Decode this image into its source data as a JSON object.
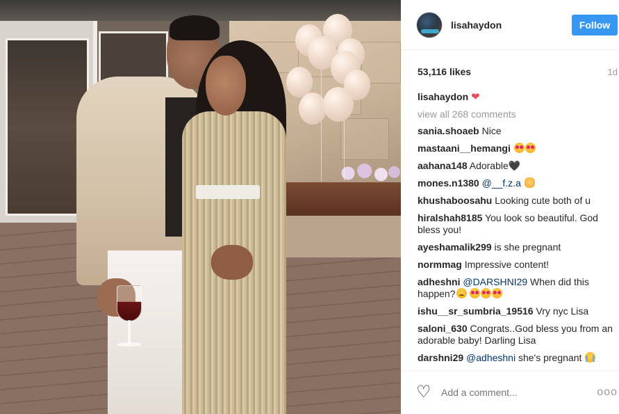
{
  "post": {
    "username": "lisahaydon",
    "follow_label": "Follow",
    "likes": "53,116 likes",
    "time": "1d",
    "caption_user": "lisahaydon",
    "caption_heart": "❤",
    "view_all": "view all 268 comments"
  },
  "comments": [
    {
      "user": "sania.shoaeb",
      "text": "Nice"
    },
    {
      "user": "mastaani__hemangi",
      "text": ""
    },
    {
      "user": "aahana148",
      "text": "Adorable🖤"
    },
    {
      "user": "mones.n1380",
      "mention": "@__f.z.a",
      "text": ""
    },
    {
      "user": "khushaboosahu",
      "text": "Looking cute both of u"
    },
    {
      "user": "hiralshah8185",
      "text": "You look so beautiful. God bless you!"
    },
    {
      "user": "ayeshamalik299",
      "text": "is she pregnant"
    },
    {
      "user": "normmag",
      "text": "Impressive content!"
    },
    {
      "user": "adheshni",
      "mention": "@DARSHNI29",
      "text": "When did this happen?"
    },
    {
      "user": "ishu__sr_sumbria_19516",
      "text": "Vry nyc Lisa"
    },
    {
      "user": "saloni_630",
      "text": "Congrats..God bless you from an adorable baby! Darling Lisa"
    },
    {
      "user": "darshni29",
      "mention": "@adheshni",
      "text": "she's pregnant"
    }
  ],
  "footer": {
    "heart_icon": "heart-outline-icon",
    "add_comment_placeholder": "Add a comment...",
    "more_label": "ooo"
  },
  "colors": {
    "follow_button": "#3897f0",
    "mention": "#003569",
    "heart": "#ed4956"
  }
}
